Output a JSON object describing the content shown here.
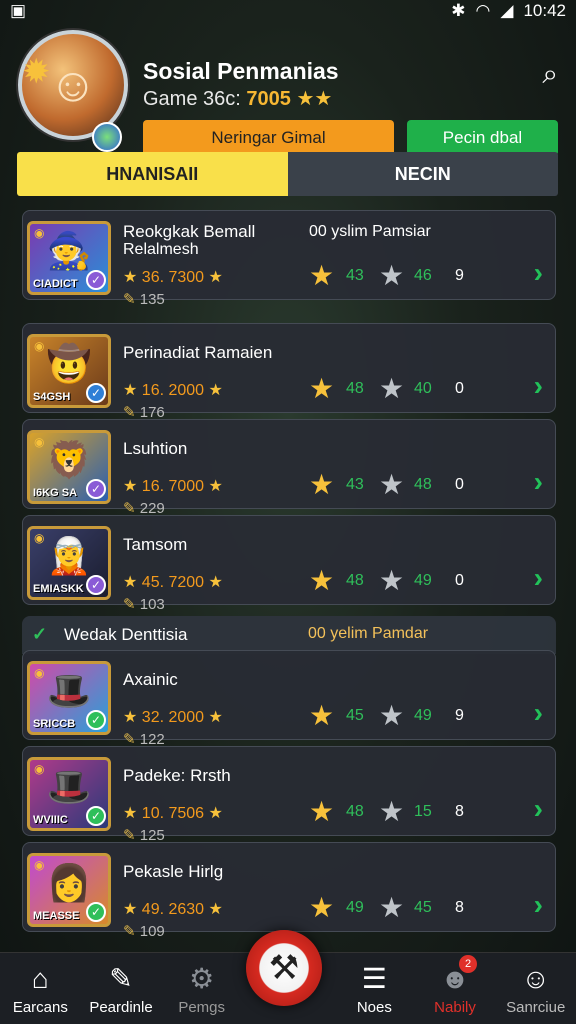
{
  "status_bar": {
    "time": "10:42",
    "left_icon": "app-icon",
    "icons": [
      "bluetooth-icon",
      "wifi-icon",
      "signal-icon"
    ]
  },
  "profile": {
    "name": "Sosial Penmanias",
    "score_prefix": "Game 36c:",
    "score_value": "7005",
    "score_stars": "★★",
    "primary_button": "Neringar Gimal",
    "secondary_button": "Pecin dbal"
  },
  "tabs": [
    {
      "label": "HNANISAII",
      "active": true
    },
    {
      "label": "NECIN",
      "active": false
    }
  ],
  "rows": [
    {
      "title": "Reokgkak Bemall",
      "title2": "Relalmesh",
      "meta": "00 yslim Pamsiar",
      "score": "36. 7300",
      "sub": "135",
      "thumb_tag": "CIADICT",
      "gold": "43",
      "silver": "46",
      "count": "9",
      "check_color": "#8a5bd6",
      "thumb_colors": [
        "#7a3bb0",
        "#2a8fd8"
      ]
    },
    {
      "title": "Perinadiat Ramaien",
      "title2": "",
      "meta": "",
      "score": "16. 2000",
      "sub": "176",
      "thumb_tag": "S4GSH",
      "gold": "48",
      "silver": "40",
      "count": "0",
      "check_color": "#2f7fd6",
      "thumb_colors": [
        "#c9842a",
        "#6b3a1a"
      ]
    },
    {
      "title": "Lsuhtion",
      "title2": "",
      "meta": "",
      "score": "16. 7000",
      "sub": "229",
      "thumb_tag": "I6KG SA",
      "gold": "43",
      "silver": "48",
      "count": "0",
      "check_color": "#8a5bd6",
      "thumb_colors": [
        "#d9a22a",
        "#2a5fb0"
      ]
    },
    {
      "title": "Tamsom",
      "title2": "",
      "meta": "",
      "score": "45. 7200",
      "sub": "103",
      "thumb_tag": "EMIASKK",
      "gold": "48",
      "silver": "49",
      "count": "0",
      "check_color": "#8a5bd6",
      "thumb_colors": [
        "#3a3f6a",
        "#1a1d2e"
      ]
    },
    {
      "title": "Axainic",
      "title2": "",
      "meta": "",
      "score": "32. 2000",
      "sub": "122",
      "thumb_tag": "SRICCB",
      "gold": "45",
      "silver": "49",
      "count": "9",
      "check_color": "#2fbf5a",
      "thumb_colors": [
        "#d04aa8",
        "#2aa0d8"
      ]
    },
    {
      "title": "Padeke: Rrsth",
      "title2": "",
      "meta": "",
      "score": "10. 7506",
      "sub": "125",
      "thumb_tag": "WVIIIC",
      "gold": "48",
      "silver": "15",
      "count": "8",
      "check_color": "#2fbf5a",
      "thumb_colors": [
        "#b03a8a",
        "#2a3a7a"
      ]
    },
    {
      "title": "Pekasle Hirlg",
      "title2": "",
      "meta": "",
      "score": "49. 2630",
      "sub": "109",
      "thumb_tag": "MEASSE",
      "gold": "49",
      "silver": "45",
      "count": "8",
      "check_color": "#2fbf5a",
      "thumb_colors": [
        "#c04ad0",
        "#d88a2a"
      ]
    }
  ],
  "section": {
    "title": "Wedak Denttisia",
    "meta": "00 yelim Pamdar"
  },
  "bottom_nav": [
    {
      "label": "Earcans",
      "icon": "home-icon",
      "badge": ""
    },
    {
      "label": "Peardinle",
      "icon": "edit-icon",
      "badge": ""
    },
    {
      "label": "Pemgs",
      "icon": "tools-icon",
      "badge": ""
    },
    {
      "label": "Noes",
      "icon": "list-icon",
      "badge": ""
    },
    {
      "label": "Nabily",
      "icon": "user-icon",
      "badge": "2"
    },
    {
      "label": "Sanrciue",
      "icon": "person-icon",
      "badge": ""
    }
  ],
  "colors": {
    "accent_yellow": "#f9e04a",
    "accent_orange": "#f39a1d",
    "accent_green": "#1fb04a",
    "alert_red": "#e0302a"
  }
}
